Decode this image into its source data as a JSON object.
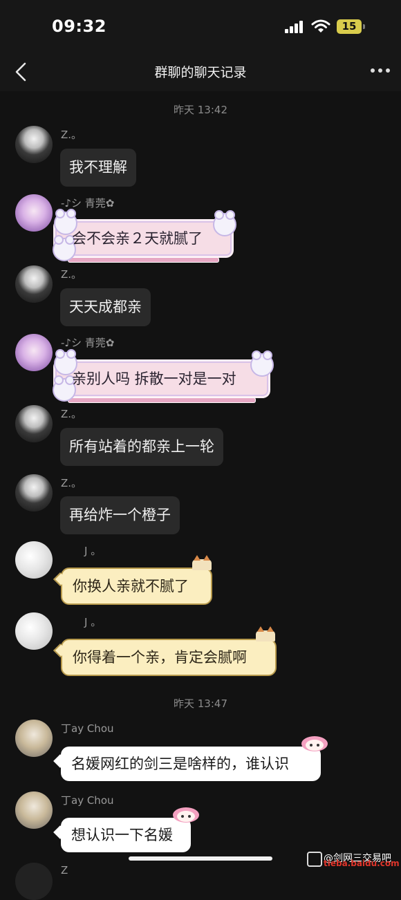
{
  "status_bar": {
    "time": "09:32",
    "battery": "15"
  },
  "nav": {
    "title": "群聊的聊天记录"
  },
  "dividers": [
    "昨天 13:42",
    "昨天 13:47"
  ],
  "messages": [
    {
      "sender": "Z.。",
      "text": "我不理解"
    },
    {
      "sender": "-♪シ 青莞✿",
      "text": "会不会亲２天就腻了"
    },
    {
      "sender": "Z.。",
      "text": "天天成都亲"
    },
    {
      "sender": "-♪シ 青莞✿",
      "text": "亲别人吗 拆散一对是一对"
    },
    {
      "sender": "Z.。",
      "text": "所有站着的都亲上一轮"
    },
    {
      "sender": "Z.。",
      "text": "再给炸一个橙子"
    },
    {
      "sender": "J 。",
      "text": "你换人亲就不腻了"
    },
    {
      "sender": "J 。",
      "text": "你得着一个亲，肯定会腻啊"
    },
    {
      "sender": "丁ay Chou",
      "text": "名媛网红的剑三是啥样的，谁认识"
    },
    {
      "sender": "丁ay Chou",
      "text": "想认识一下名媛"
    },
    {
      "sender": "Z"
    }
  ],
  "watermark": {
    "text": "@剑网三交易吧",
    "sub": "tieba.baidu.com"
  },
  "colors": {
    "background": "#121212",
    "bubble": "#2a2a2a",
    "pink_bubble": "#f6dde6",
    "cream_bubble": "#fbeec0"
  }
}
